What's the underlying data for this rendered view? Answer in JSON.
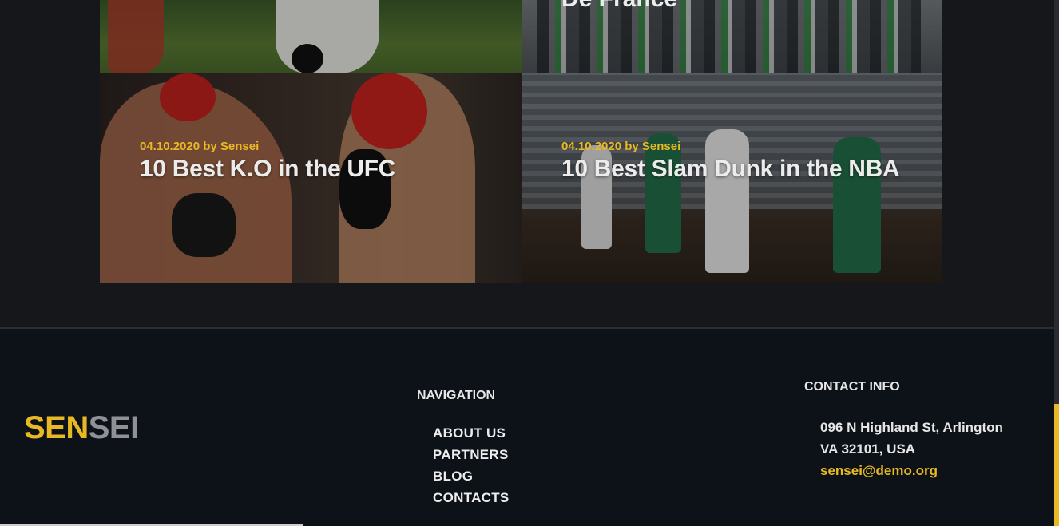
{
  "cards": [
    {
      "title": "",
      "meta": ""
    },
    {
      "title": "De France",
      "meta": ""
    },
    {
      "meta": "04.10.2020 by Sensei",
      "title": "10 Best K.O in the UFC"
    },
    {
      "meta": "04.10.2020 by Sensei",
      "title": "10 Best Slam Dunk in the NBA"
    }
  ],
  "footer": {
    "logo_part1": "SEN",
    "logo_part2": "SEI",
    "nav_heading": "NAVIGATION",
    "nav_items": [
      "ABOUT US",
      "PARTNERS",
      "BLOG",
      "CONTACTS"
    ],
    "contact_heading": "CONTACT INFO",
    "address_line1": "096 N Highland St, Arlington",
    "address_line2": "VA 32101, USA",
    "email": "sensei@demo.org"
  },
  "colors": {
    "accent": "#e8b923",
    "background": "#16171b",
    "footer": "#0d1118"
  }
}
